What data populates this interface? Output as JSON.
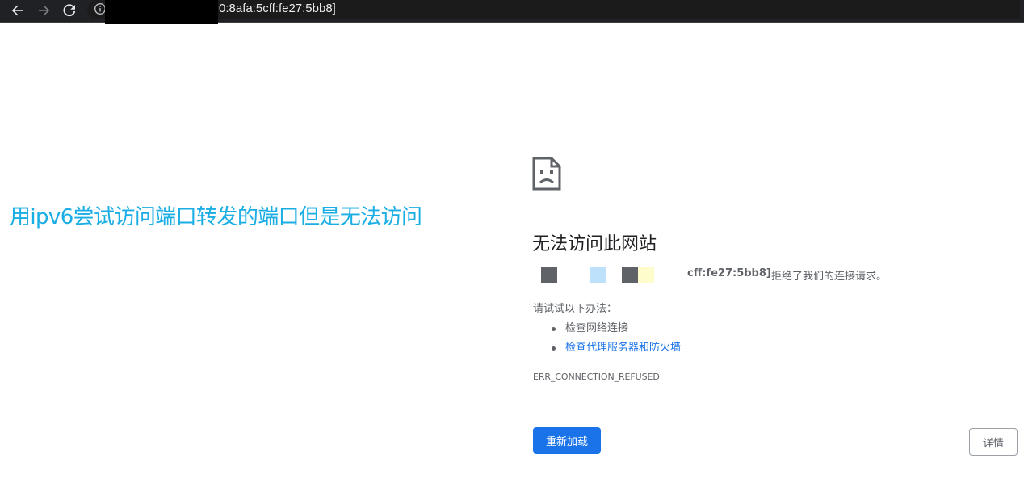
{
  "browser": {
    "url_visible": "0:8afa:5cff:fe27:5bb8]",
    "icons": {
      "back": "arrow-left-icon",
      "forward": "arrow-right-icon",
      "reload": "reload-icon",
      "site_info": "info-icon"
    },
    "colors": {
      "toolbar_bg": "#202124",
      "redaction": "#000000"
    }
  },
  "annotation": {
    "text": "用ipv6尝试访问端口转发的端口但是无法访问",
    "color": "#1aaee4"
  },
  "error_page": {
    "icon": "sad-page-icon",
    "title": "无法访问此网站",
    "host_tail": "cff:fe27:5bb8]",
    "refused_message": "拒绝了我们的连接请求。",
    "try_label": "请试试以下办法：",
    "suggestions": [
      {
        "text": "检查网络连接",
        "link": false
      },
      {
        "text": "检查代理服务器和防火墙",
        "link": true
      }
    ],
    "error_code": "ERR_CONNECTION_REFUSED",
    "reload_button": "重新加载",
    "details_button": "详情",
    "colors": {
      "primary": "#1a73e8",
      "text": "#5f6368",
      "title": "#202124",
      "mosaic": [
        "#5f6368",
        "#bde1fb",
        "#5f6368",
        "#fefccb"
      ]
    }
  }
}
